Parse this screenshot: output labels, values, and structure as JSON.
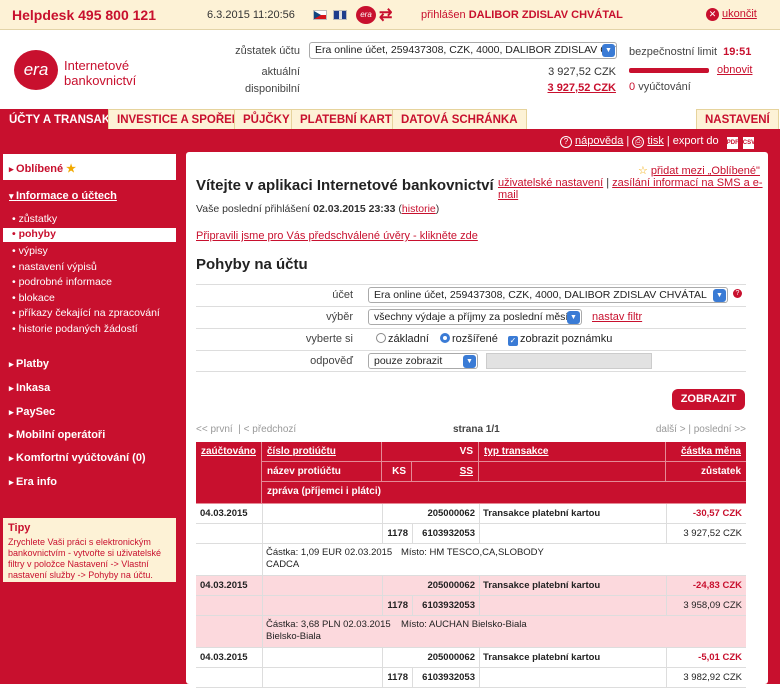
{
  "topbar": {
    "helpdesk": "Helpdesk 495 800 121",
    "datetime": "6.3.2015  11:20:56",
    "user_prefix": "přihlášen",
    "user_name": "DALIBOR ZDISLAV CHVÁTAL",
    "logout": "ukončit",
    "mini_logo": "era"
  },
  "brand": {
    "logo": "era",
    "name": "Internetové bankovnictví"
  },
  "account": {
    "balance_label": "zůstatek účtu",
    "selected": "Era online účet, 259437308, CZK, 4000, DALIBOR ZDISLAV CHVÁTAL",
    "current_label": "aktuální",
    "current_value": "3 927,52 CZK",
    "available_label": "disponibilní",
    "available_value": "3 927,52 CZK"
  },
  "security": {
    "limit_label": "bezpečnostní limit",
    "limit_time": "19:51",
    "renew": "obnovit",
    "vyuct_count": "0",
    "vyuct_label": "vyúčtování"
  },
  "tabs": [
    {
      "label": "ÚČTY A TRANSAKCE"
    },
    {
      "label": "INVESTICE A SPOŘENÍ"
    },
    {
      "label": "PŮJČKY"
    },
    {
      "label": "PLATEBNÍ KARTY"
    },
    {
      "label": "DATOVÁ SCHRÁNKA"
    },
    {
      "label": "NASTAVENÍ"
    }
  ],
  "subbar": {
    "help": "nápověda",
    "print": "tisk",
    "export": "export do",
    "pdf": "PDF",
    "csv": "CSV"
  },
  "sidebar": {
    "favorites": "Oblíbené",
    "info_head": "Informace o účtech",
    "sub": [
      "zůstatky",
      "pohyby",
      "výpisy",
      "nastavení výpisů",
      "podrobné informace",
      "blokace",
      "příkazy čekající na zpracování",
      "historie podaných žádostí"
    ],
    "sections": [
      "Platby",
      "Inkasa",
      "PaySec",
      "Mobilní operátoři",
      "Komfortní vyúčtování (0)",
      "Era info"
    ],
    "tips_title": "Tipy",
    "tips_text": "Zrychlete Vaši práci s elektronickým bankovnictvím - vytvořte si uživatelské filtry v položce Nastavení -> Vlastní nastavení služby -> Pohyby na účtu."
  },
  "main": {
    "add_fav": "přidat mezi „Oblíbené\"",
    "welcome": "Vítejte v aplikaci Internetové bankovnictví",
    "user_settings": "uživatelské nastavení",
    "sms_link": "zasílání informací na SMS a e-mail",
    "last_login_label": "Vaše poslední přihlášení",
    "last_login_value": "02.03.2015 23:33",
    "history": "historie",
    "preapproved": "Připravili jsme pro Vás předschválené úvěry - klikněte zde",
    "section_title": "Pohyby na účtu"
  },
  "filter": {
    "account_label": "účet",
    "account_value": "Era online účet, 259437308, CZK, 4000, DALIBOR ZDISLAV CHVÁTAL",
    "select_label": "výběr",
    "select_value": "všechny výdaje a příjmy za poslední měsíc",
    "set_filter": "nastav filtr",
    "choose_label": "vyberte si",
    "opt_basic": "základní",
    "opt_extended": "rozšířené",
    "opt_notes": "zobrazit poznámku",
    "answer_label": "odpověď",
    "answer_value": "pouze zobrazit",
    "show_button": "ZOBRAZIT"
  },
  "pager": {
    "first": "<< první",
    "prev": "< předchozí",
    "page": "strana 1/1",
    "next": "další >",
    "last": "poslední >>"
  },
  "table": {
    "h_date": "zaúčtováno",
    "h_acc": "číslo protiúčtu",
    "h_vs": "VS",
    "h_type": "typ transakce",
    "h_amount": "částka měna",
    "h_name": "název protiúčtu",
    "h_ks": "KS",
    "h_ss": "SS",
    "h_balance": "zůstatek",
    "h_msg": "zpráva (příjemci i plátci)",
    "rows": [
      {
        "date": "04.03.2015",
        "vs": "205000062",
        "type": "Transakce platební kartou",
        "amount": "-30,57 CZK",
        "ks": "1178",
        "ss": "6103932053",
        "balance": "3 927,52 CZK",
        "note1": "Částka: 1,09 EUR 02.03.2015",
        "note2": "Místo: HM TESCO,CA,SLOBODY",
        "note3": "CADCA"
      },
      {
        "date": "04.03.2015",
        "vs": "205000062",
        "type": "Transakce platební kartou",
        "amount": "-24,83 CZK",
        "ks": "1178",
        "ss": "6103932053",
        "balance": "3 958,09 CZK",
        "note1": "Částka: 3,68 PLN 02.03.2015",
        "note2": "Místo: AUCHAN Bielsko-Biala",
        "note3": "Bielsko-Biala"
      },
      {
        "date": "04.03.2015",
        "vs": "205000062",
        "type": "Transakce platební kartou",
        "amount": "-5,01 CZK",
        "ks": "1178",
        "ss": "6103932053",
        "balance": "3 982,92 CZK"
      }
    ]
  }
}
